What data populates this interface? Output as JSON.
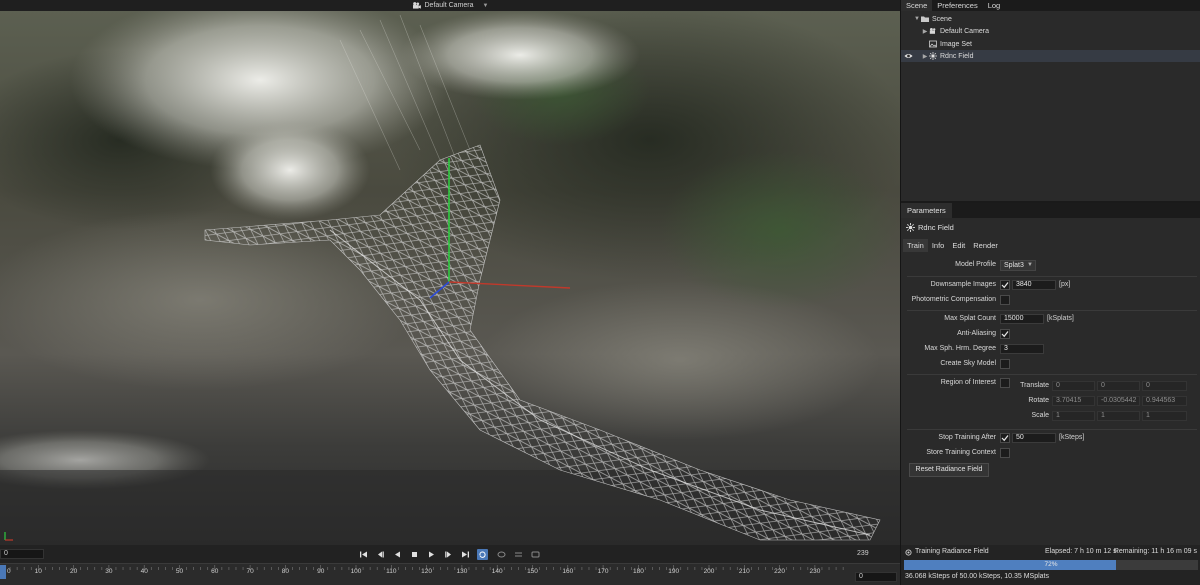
{
  "colors": {
    "accent": "#4f7fbf",
    "axis_x": "#c0392b",
    "axis_y": "#2ecc40",
    "axis_z": "#2c4ad8"
  },
  "viewport": {
    "camera_label": "Default Camera",
    "camera_icon": "camera-icon",
    "dropdown_icon": "chevron-down-icon"
  },
  "panel_tabs": [
    "Scene",
    "Preferences",
    "Log"
  ],
  "scene_tree": [
    {
      "label": "Scene",
      "icon": "folder-icon",
      "expanded": true,
      "level": 0
    },
    {
      "label": "Default Camera",
      "icon": "camera-icon",
      "expanded": false,
      "level": 1
    },
    {
      "label": "Image Set",
      "icon": "image-set-icon",
      "expanded": false,
      "level": 1
    },
    {
      "label": "Rdnc Field",
      "icon": "radiance-field-icon",
      "expanded": false,
      "level": 1,
      "selected": true,
      "visible": true
    }
  ],
  "parameters": {
    "header": "Parameters",
    "object_title": "Rdnc Field",
    "tabs": [
      "Train",
      "Info",
      "Edit",
      "Render"
    ],
    "active_tab": "Train",
    "model_profile": {
      "label": "Model Profile",
      "value": "Splat3"
    },
    "downsample_images": {
      "label": "Downsample Images",
      "checked": true,
      "value": "3840",
      "unit": "[px]"
    },
    "photometric_compensation": {
      "label": "Photometric Compensation",
      "checked": false
    },
    "max_splat_count": {
      "label": "Max Splat Count",
      "value": "15000",
      "unit": "[kSplats]"
    },
    "anti_aliasing": {
      "label": "Anti-Aliasing",
      "checked": true
    },
    "max_sph_degree": {
      "label": "Max Sph. Hrm. Degree",
      "value": "3"
    },
    "create_sky_model": {
      "label": "Create Sky Model",
      "checked": false
    },
    "region_of_interest": {
      "label": "Region of Interest",
      "checked": false,
      "translate": {
        "label": "Translate",
        "values": [
          "0",
          "0",
          "0"
        ]
      },
      "rotate": {
        "label": "Rotate",
        "values": [
          "3.70415",
          "-0.0305442",
          "0.944563"
        ]
      },
      "scale": {
        "label": "Scale",
        "values": [
          "1",
          "1",
          "1"
        ]
      }
    },
    "stop_training_after": {
      "label": "Stop Training After",
      "checked": true,
      "value": "50",
      "unit": "[kSteps]"
    },
    "store_training_context": {
      "label": "Store Training Context",
      "checked": false
    },
    "reset_button": "Reset Radiance Field"
  },
  "transport": {
    "start_frame": "0",
    "end_frame": "239",
    "buttons": [
      "skip-to-start-icon",
      "step-back-icon",
      "play-reverse-icon",
      "stop-icon",
      "play-icon",
      "step-forward-icon",
      "skip-to-end-icon",
      "loop-icon",
      "bounce-icon",
      "record-icon"
    ]
  },
  "timeline": {
    "ticks": [
      "0",
      "10",
      "20",
      "30",
      "40",
      "50",
      "60",
      "70",
      "80",
      "90",
      "100",
      "110",
      "120",
      "130",
      "140",
      "150",
      "160",
      "170",
      "180",
      "190",
      "200",
      "210",
      "220",
      "230"
    ],
    "current_time": "0"
  },
  "status": {
    "task": "Training Radiance Field",
    "elapsed": "Elapsed: 7 h 10 m 12 s",
    "remaining": "Remaining: 11 h 16 m 09 s",
    "progress": 0.72,
    "progress_label": "72%",
    "detail": "36.068 kSteps of 50.00 kSteps, 10.35 MSplats"
  }
}
